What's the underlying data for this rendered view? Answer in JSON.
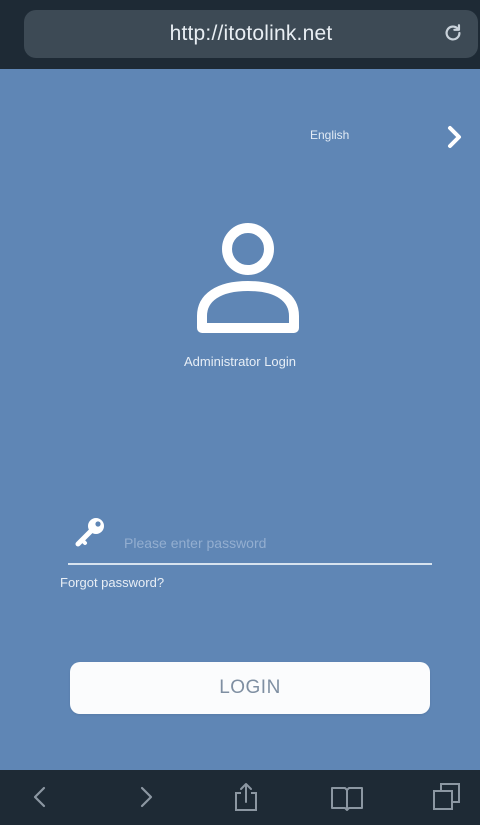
{
  "browser": {
    "url": "http://itotolink.net",
    "icons": {
      "reload": "reload-icon",
      "back": "back-icon",
      "forward": "forward-icon",
      "share": "share-icon",
      "bookmarks": "bookmarks-icon",
      "tabs": "tabs-icon"
    }
  },
  "page": {
    "language": "English",
    "login_title": "Administrator Login",
    "password_placeholder": "Please enter password",
    "forgot_password": "Forgot password?",
    "login_button": "LOGIN",
    "icons": {
      "language_next": "chevron-right-icon",
      "avatar": "user-avatar-icon",
      "password": "key-icon"
    }
  },
  "colors": {
    "background": "#5f86b5",
    "browser_chrome": "#1e2a35",
    "url_field": "#3d4a55",
    "button_bg": "#fbfcfd",
    "button_text": "#7f8fa2"
  }
}
